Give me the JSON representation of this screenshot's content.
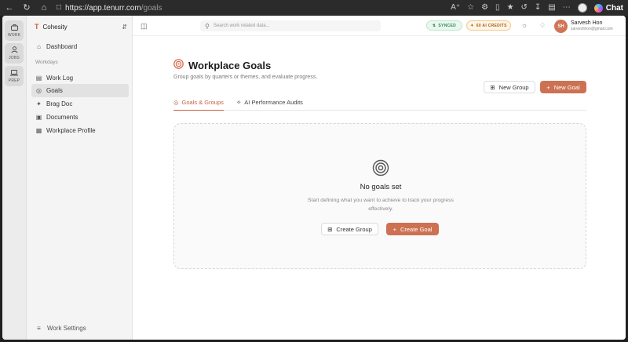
{
  "browser": {
    "url_main": "https://app.tenurr.com",
    "url_path": "/goals",
    "chat_label": "Chat"
  },
  "rail": {
    "items": [
      {
        "label": "WORK",
        "icon": "briefcase-icon"
      },
      {
        "label": "JOBS",
        "icon": "person-icon"
      },
      {
        "label": "PREP",
        "icon": "laptop-icon"
      }
    ]
  },
  "sidebar": {
    "org_name": "Cohesity",
    "dashboard": "Dashboard",
    "section_label": "Workdays",
    "items": [
      {
        "label": "Work Log",
        "icon": "log-icon"
      },
      {
        "label": "Goals",
        "icon": "target-icon"
      },
      {
        "label": "Brag Doc",
        "icon": "sparkle-icon"
      },
      {
        "label": "Documents",
        "icon": "folder-icon"
      },
      {
        "label": "Workplace Profile",
        "icon": "building-icon"
      }
    ],
    "settings_label": "Work Settings"
  },
  "header": {
    "search_placeholder": "Search work related data...",
    "synced_label": "SYNCED",
    "credits_label": "60 AI CREDITS",
    "user_initials": "SH",
    "user_name": "Sarvesh Hon",
    "user_email": "sarveshhon@gmail.com"
  },
  "main": {
    "title": "Workplace Goals",
    "subtitle": "Group goals by quarters or themes, and evaluate progress.",
    "new_group_label": "New Group",
    "new_goal_label": "New Goal",
    "tabs": [
      {
        "label": "Goals & Groups"
      },
      {
        "label": "AI Performance Audits"
      }
    ],
    "empty": {
      "title": "No goals set",
      "description": "Start defining what you want to achieve to track your progress effectively.",
      "create_group_label": "Create Group",
      "create_goal_label": "Create Goal"
    }
  },
  "colors": {
    "accent": "#cc7252",
    "synced": "#2c8a52",
    "credits": "#a06418"
  }
}
